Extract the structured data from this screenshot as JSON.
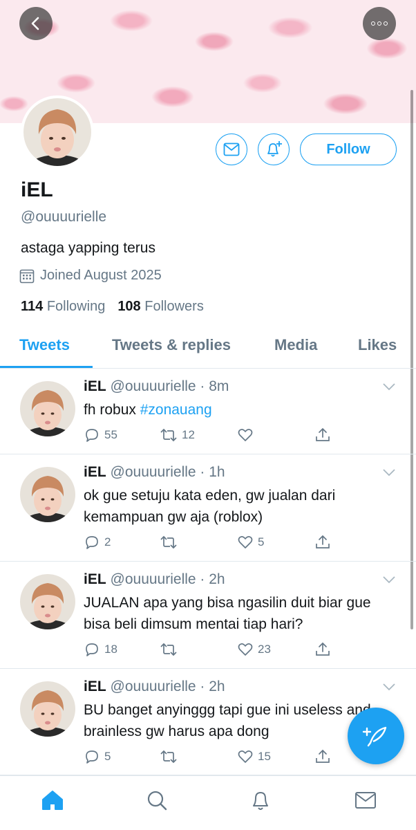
{
  "profile": {
    "display_name": "iEL",
    "handle": "@ouuuurielle",
    "bio": "astaga yapping terus",
    "joined": "Joined August 2025",
    "following_count": "114",
    "following_label": "Following",
    "followers_count": "108",
    "followers_label": "Followers",
    "follow_label": "Follow"
  },
  "tabs": [
    {
      "label": "Tweets",
      "active": true
    },
    {
      "label": "Tweets & replies",
      "active": false
    },
    {
      "label": "Media",
      "active": false
    },
    {
      "label": "Likes",
      "active": false
    }
  ],
  "tweets": [
    {
      "name": "iEL",
      "meta": "@ouuuurielle · 8m",
      "text": "fh robux ",
      "hashtag": "#zonauang",
      "replies": "55",
      "retweets": "12",
      "likes": ""
    },
    {
      "name": "iEL",
      "meta": "@ouuuurielle · 1h",
      "text": "ok gue setuju kata eden, gw jualan dari kemampuan gw aja (roblox)",
      "replies": "2",
      "retweets": "",
      "likes": "5"
    },
    {
      "name": "iEL",
      "meta": "@ouuuurielle · 2h",
      "text": "JUALAN apa yang bisa ngasilin duit biar gue bisa beli dimsum mentai tiap hari?",
      "replies": "18",
      "retweets": "",
      "likes": "23"
    },
    {
      "name": "iEL",
      "meta": "@ouuuurielle · 2h",
      "text": "BU banget anyinggg tapi gue ini useless and brainless gw harus apa dong",
      "replies": "5",
      "retweets": "",
      "likes": "15"
    }
  ],
  "icons": {
    "back": "chevron-left-icon",
    "more": "more-horizontal-icon",
    "message": "envelope-icon",
    "notifications": "bell-plus-icon",
    "calendar": "calendar-icon",
    "reply": "reply-bubble-icon",
    "retweet": "retweet-icon",
    "like": "heart-icon",
    "share": "share-icon",
    "compose": "compose-feather-icon",
    "home": "home-icon",
    "search": "search-icon",
    "bell": "bell-icon",
    "mail": "mail-icon"
  },
  "colors": {
    "accent": "#1da1f2",
    "muted": "#657786",
    "text": "#14171a",
    "divider": "#e1e8ed"
  }
}
